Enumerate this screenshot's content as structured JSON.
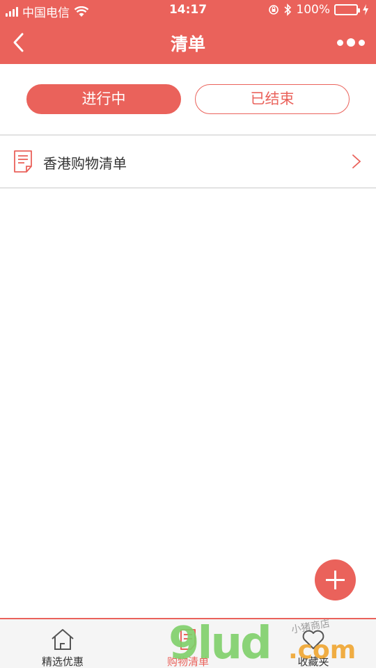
{
  "status_bar": {
    "carrier": "中国电信",
    "time": "14:17",
    "battery_percent": "100%",
    "battery_level": 1.0,
    "icons": [
      "signal-icon",
      "wifi-icon",
      "orientation-lock-icon",
      "bluetooth-icon",
      "battery-icon",
      "charging-icon"
    ]
  },
  "nav": {
    "title": "清单",
    "back_icon": "chevron-left-icon",
    "more_icon": "more-dots-icon"
  },
  "tabs": [
    {
      "label": "进行中",
      "active": true
    },
    {
      "label": "已结束",
      "active": false
    }
  ],
  "list": [
    {
      "label": "香港购物清单",
      "icon": "document-icon"
    }
  ],
  "fab": {
    "icon": "plus-icon"
  },
  "tab_bar": [
    {
      "label": "精选优惠",
      "icon": "home-icon",
      "active": false
    },
    {
      "label": "购物清单",
      "icon": "list-icon",
      "active": true
    },
    {
      "label": "收藏夹",
      "icon": "heart-icon",
      "active": false
    }
  ],
  "watermark": {
    "text": "9lud",
    "suffix": ".com",
    "sign": "小猪商店"
  },
  "colors": {
    "accent": "#ea625b",
    "battery": "#4cd964",
    "divider": "#e2e2e2"
  }
}
